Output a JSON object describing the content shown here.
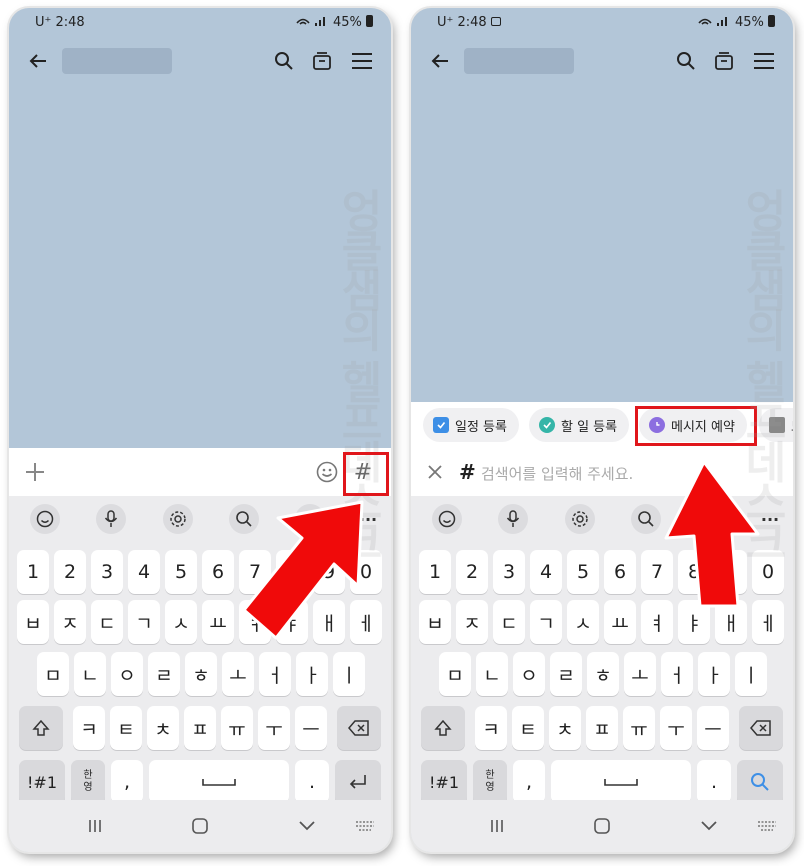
{
  "left": {
    "status": {
      "time": "U⁺ 2:48",
      "battery": "45%"
    },
    "input_hash": "#",
    "tools": [
      "emoji-icon",
      "mic-icon",
      "gear-icon",
      "search-icon",
      "sticker-icon",
      "more-icon"
    ],
    "row1": [
      "1",
      "2",
      "3",
      "4",
      "5",
      "6",
      "7",
      "8",
      "9",
      "0"
    ],
    "row2": [
      "ㅂ",
      "ㅈ",
      "ㄷ",
      "ㄱ",
      "ㅅ",
      "ㅛ",
      "ㅕ",
      "ㅑ",
      "ㅐ",
      "ㅔ"
    ],
    "row3": [
      "ㅁ",
      "ㄴ",
      "ㅇ",
      "ㄹ",
      "ㅎ",
      "ㅗ",
      "ㅓ",
      "ㅏ",
      "ㅣ"
    ],
    "row4": [
      "ㅋ",
      "ㅌ",
      "ㅊ",
      "ㅍ",
      "ㅠ",
      "ㅜ",
      "ㅡ"
    ],
    "sym": "!#1",
    "lang_top": "한",
    "lang_bot": "영",
    "comma": ",",
    "period": "."
  },
  "right": {
    "status": {
      "time": "U⁺ 2:48",
      "battery": "45%"
    },
    "chips": [
      "일정 등록",
      "할 일 등록",
      "메시지 예약",
      "노"
    ],
    "search_hash": "#",
    "search_placeholder": "검색어를 입력해 주세요.",
    "row1": [
      "1",
      "2",
      "3",
      "4",
      "5",
      "6",
      "7",
      "8",
      "9",
      "0"
    ],
    "row2": [
      "ㅂ",
      "ㅈ",
      "ㄷ",
      "ㄱ",
      "ㅅ",
      "ㅛ",
      "ㅕ",
      "ㅑ",
      "ㅐ",
      "ㅔ"
    ],
    "row3": [
      "ㅁ",
      "ㄴ",
      "ㅇ",
      "ㄹ",
      "ㅎ",
      "ㅗ",
      "ㅓ",
      "ㅏ",
      "ㅣ"
    ],
    "row4": [
      "ㅋ",
      "ㅌ",
      "ㅊ",
      "ㅍ",
      "ㅠ",
      "ㅜ",
      "ㅡ"
    ],
    "sym": "!#1",
    "lang_top": "한",
    "lang_bot": "영",
    "comma": ",",
    "period": "."
  },
  "watermark": "엉클샘의 헬프데스크",
  "colors": {
    "highlight": "#e0161b",
    "chat_bg": "#b3c6d8",
    "chip_purple": "#8c6ee0",
    "chip_teal": "#35b5a8",
    "chip_blue": "#3d8fe6"
  }
}
